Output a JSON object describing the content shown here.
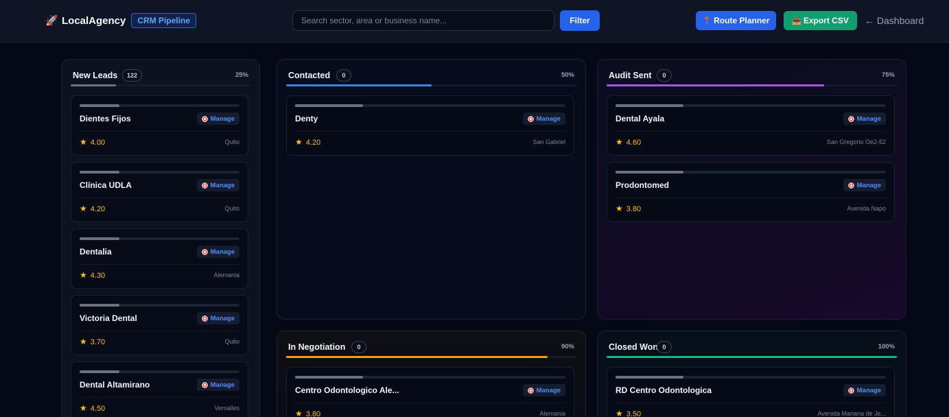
{
  "header": {
    "brand_name": "LocalAgency",
    "badge": "CRM Pipeline",
    "search_placeholder": "Search sector, area or business name...",
    "filter_label": "Filter",
    "route_label": "Route Planner",
    "export_label": "Export CSV",
    "dashboard_label": "← Dashboard",
    "icons": {
      "brand": "rocket-icon",
      "route": "pin-icon",
      "export": "tray-icon"
    }
  },
  "colors": {
    "new_leads": "#64748b",
    "contacted": "#3b82f6",
    "audit_sent": "#a855f7",
    "in_negotiation": "#f59e0b",
    "closed_won": "#10b981",
    "rating": "#fbbf24",
    "manage": "#4f8ef7"
  },
  "columns": [
    {
      "title": "New Leads",
      "count": "122",
      "pct": "25%",
      "progress": 0.25,
      "cards": [
        {
          "name": "Dientes Fijos",
          "rating": "4.00",
          "area": "Quito",
          "manage": "Manage"
        },
        {
          "name": "Clínica UDLA",
          "rating": "4.20",
          "area": "Quito",
          "manage": "Manage"
        },
        {
          "name": "Dentalia",
          "rating": "4.30",
          "area": "Alemania",
          "manage": "Manage"
        },
        {
          "name": "Victoria Dental",
          "rating": "3.70",
          "area": "Quito",
          "manage": "Manage"
        },
        {
          "name": "Dental Altamirano",
          "rating": "4.50",
          "area": "Versalles",
          "manage": "Manage"
        }
      ]
    },
    {
      "title": "Contacted",
      "count": "0",
      "pct": "50%",
      "progress": 0.5,
      "cards": [
        {
          "name": "Denty",
          "rating": "4.20",
          "area": "San Gabriel",
          "manage": "Manage"
        }
      ]
    },
    {
      "title": "Audit Sent",
      "count": "0",
      "pct": "75%",
      "progress": 0.75,
      "cards": [
        {
          "name": "Dental Ayala",
          "rating": "4.60",
          "area": "San Gregorio Oe2-52",
          "manage": "Manage"
        },
        {
          "name": "Prodontomed",
          "rating": "3.80",
          "area": "Avenida Napo",
          "manage": "Manage"
        }
      ]
    },
    {
      "title": "In Negotiation",
      "count": "0",
      "pct": "90%",
      "progress": 0.9,
      "cards": [
        {
          "name": "Centro Odontologico Ale...",
          "rating": "3.80",
          "area": "Alemania",
          "manage": "Manage"
        }
      ]
    },
    {
      "title": "Closed Won",
      "count": "0",
      "pct": "100%",
      "progress": 1.0,
      "cards": [
        {
          "name": "RD Centro Odontologica",
          "rating": "3.50",
          "area": "Avenida Mariana de Je...",
          "manage": "Manage"
        }
      ]
    }
  ],
  "star_glyph": "★"
}
